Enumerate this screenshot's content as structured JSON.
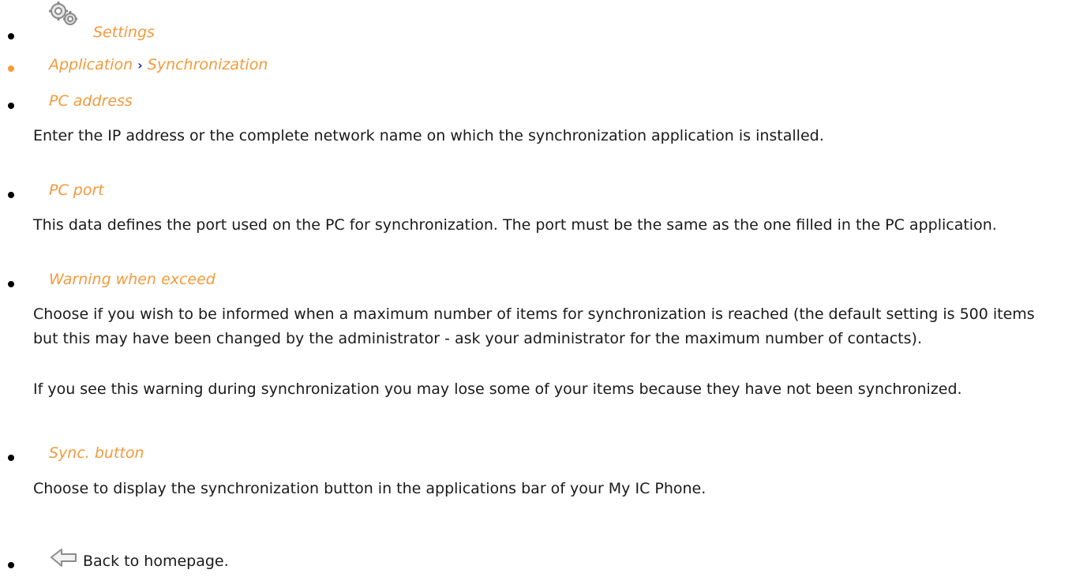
{
  "items": {
    "settings": {
      "label": "Settings",
      "icon": "gears-icon"
    },
    "breadcrumb": {
      "part1": "Application",
      "separator": "›",
      "part2": "Synchronization"
    },
    "pc_address": {
      "title": "PC address",
      "description": " Enter the IP address or the complete network name on which the synchronization application is installed."
    },
    "pc_port": {
      "title": "PC port",
      "description": " This data defines the port used on the PC for synchronization. The port must be the same as the one filled in the PC application."
    },
    "warning_when_exceed": {
      "title": "Warning when exceed",
      "description1": " Choose if you wish to be informed when a maximum number of items for synchronization is reached (the default setting is 500 items but this may have been changed by the administrator - ask your administrator for the maximum number of contacts).",
      "description2": " If you see this warning during synchronization you may lose some of your items because they have not been synchronized."
    },
    "sync_button": {
      "title": "Sync. button",
      "description": " Choose to display the synchronization button in the applications bar of your My IC Phone."
    },
    "back": {
      "label": "Back to homepage.",
      "icon": "back-arrow-icon"
    }
  },
  "colors": {
    "accent": "#f39a3c",
    "separator": "#1f2f8a",
    "text": "#1a1a1a"
  }
}
